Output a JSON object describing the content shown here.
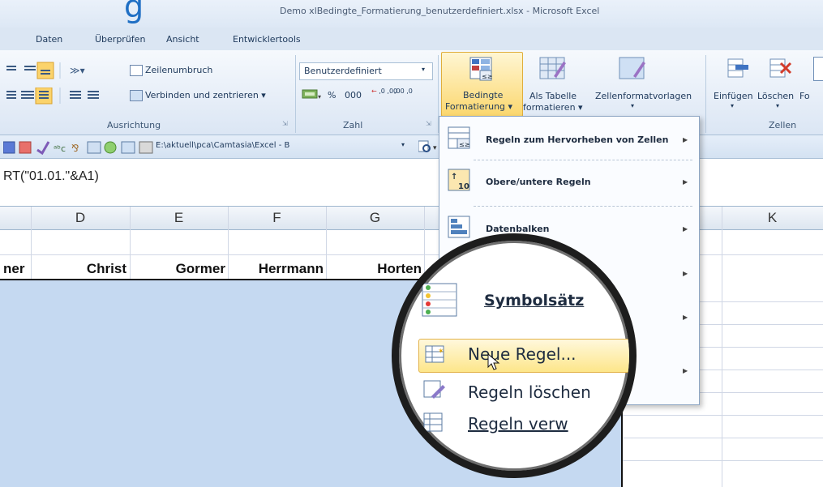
{
  "window": {
    "big_letter": "g",
    "title": "Demo xlBedingte_Formatierung_benutzerdefiniert.xlsx - Microsoft Excel"
  },
  "tabs": [
    "Daten",
    "Überprüfen",
    "Ansicht",
    "Entwicklertools"
  ],
  "ribbon": {
    "alignment": {
      "wrap_text": "Zeilenumbruch",
      "merge_center": "Verbinden und zentrieren",
      "group_label": "Ausrichtung"
    },
    "number": {
      "format_value": "Benutzerdefiniert",
      "percent": "%",
      "thousands": "000",
      "inc_decimal": " ,0 ,00",
      "dec_decimal": ",00 ,0",
      "group_label": "Zahl"
    },
    "styles": {
      "conditional_line1": "Bedingte",
      "conditional_line2": "Formatierung",
      "table_line1": "Als Tabelle",
      "table_line2": "formatieren",
      "cell_styles": "Zellenformatvorlagen"
    },
    "cells": {
      "insert": "Einfügen",
      "delete": "Löschen",
      "format_partial": "Fo",
      "group_label": "Zellen"
    }
  },
  "qat": {
    "path": "E:\\aktuell\\pca\\Camtasia\\Excel - B"
  },
  "formula_bar": {
    "content": "RT(\"01.01.\"&A1)"
  },
  "grid": {
    "columns": [
      "D",
      "E",
      "F",
      "G",
      "K"
    ],
    "header_names": [
      "ner",
      "Christ",
      "Gormer",
      "Herrmann",
      "Horten"
    ]
  },
  "menu": {
    "items": [
      {
        "label": "Regeln zum Hervorheben von Zellen",
        "has_submenu": true
      },
      {
        "label": "Obere/untere Regeln",
        "has_submenu": true
      },
      {
        "label": "Datenbalken",
        "has_submenu": true
      }
    ]
  },
  "lens": {
    "symbol_sets": "Symbolsätz",
    "new_rule": "Neue Regel...",
    "delete_rules": "Regeln löschen",
    "manage_rules": "Regeln verw"
  },
  "colors": {
    "selection_fill": "#c5d9f1",
    "highlight": "#fde68a",
    "ribbon_bg": "#dbe6f4"
  }
}
